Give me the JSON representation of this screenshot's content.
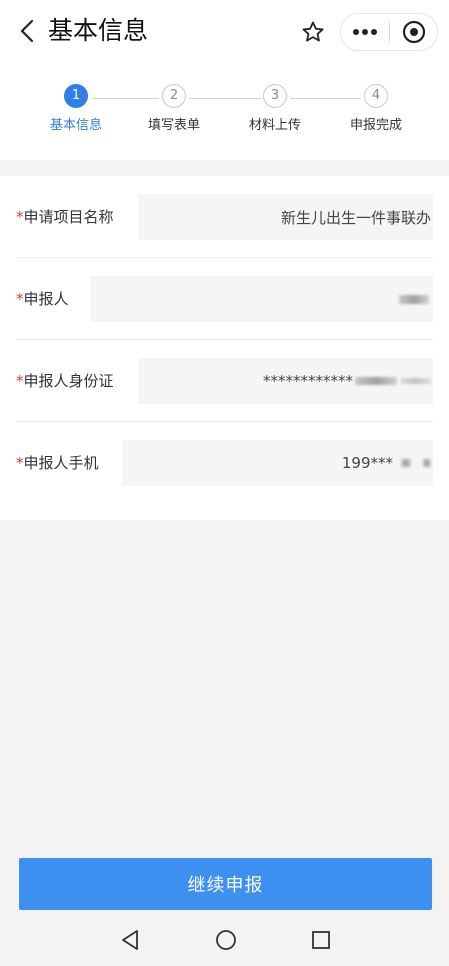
{
  "header": {
    "title": "基本信息",
    "back_icon": "chevron-left-icon",
    "favorite_icon": "star-outline-icon",
    "more_icon": "more-dots-icon",
    "close_icon": "target-circle-icon"
  },
  "steps": [
    {
      "num": "1",
      "label": "基本信息",
      "active": true
    },
    {
      "num": "2",
      "label": "填写表单",
      "active": false
    },
    {
      "num": "3",
      "label": "材料上传",
      "active": false
    },
    {
      "num": "4",
      "label": "申报完成",
      "active": false
    }
  ],
  "colors": {
    "accent": "#2f7fe8",
    "button": "#3d8ff0",
    "required": "#e53935"
  },
  "form": {
    "rows": [
      {
        "required_mark": "*",
        "label": "申请项目名称",
        "value": "新生儿出生一件事联办"
      },
      {
        "required_mark": "*",
        "label": "申报人",
        "value": ""
      },
      {
        "required_mark": "*",
        "label": "申报人身份证",
        "value": "************"
      },
      {
        "required_mark": "*",
        "label": "申报人手机",
        "value": "199***"
      }
    ]
  },
  "footer": {
    "submit_label": "继续申报"
  },
  "system_nav": {
    "back": "triangle-back-icon",
    "home": "circle-home-icon",
    "recent": "square-recent-icon"
  }
}
